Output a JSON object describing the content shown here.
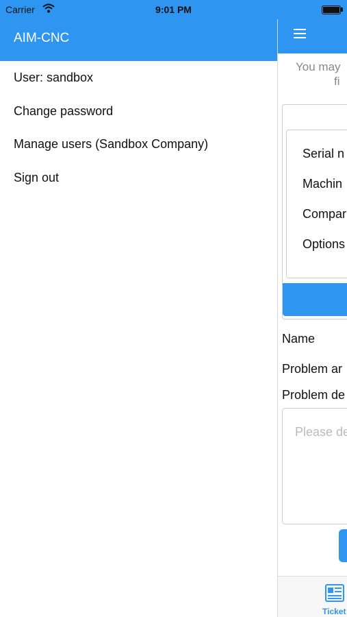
{
  "status_bar": {
    "carrier": "Carrier",
    "time": "9:01 PM"
  },
  "drawer": {
    "title": "AIM-CNC",
    "items": [
      {
        "label": "User: sandbox"
      },
      {
        "label": "Change password"
      },
      {
        "label": "Manage users (Sandbox Company)"
      },
      {
        "label": "Sign out"
      }
    ]
  },
  "main": {
    "note_line1": "You may",
    "note_line2": "fi",
    "machine_fields": [
      {
        "label": "Serial n"
      },
      {
        "label": "Machin"
      },
      {
        "label": "Compar"
      },
      {
        "label": "Options"
      }
    ],
    "name_label": "Name",
    "problem_area_label": "Problem ar",
    "problem_desc_label": "Problem de",
    "problem_desc_placeholder": "Please de",
    "tab_label": "Ticket"
  },
  "colors": {
    "accent": "#2e95f0"
  }
}
